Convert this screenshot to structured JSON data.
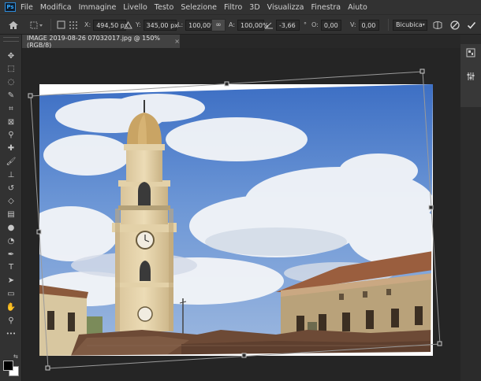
{
  "app": {
    "logo": "Ps"
  },
  "menu": [
    "File",
    "Modifica",
    "Immagine",
    "Livello",
    "Testo",
    "Selezione",
    "Filtro",
    "3D",
    "Visualizza",
    "Finestra",
    "Aiuto"
  ],
  "options": {
    "x_label": "X:",
    "x_value": "494,50 px",
    "y_label": "Y:",
    "y_value": "345,00 px",
    "w_label": "L:",
    "w_value": "100,00%",
    "h_label": "A:",
    "h_value": "100,00%",
    "angle_value": "-3,66",
    "hskew_label": "O:",
    "hskew_value": "0,00",
    "vskew_label": "V:",
    "vskew_value": "0,00",
    "interpolation": "Bicubica"
  },
  "document": {
    "tab_title": "IMAGE 2019-08-26 07032017.jpg @ 150% (RGB/8)",
    "close_glyph": "×"
  },
  "tools": [
    {
      "name": "move-icon",
      "glyph": "✥"
    },
    {
      "name": "marquee-icon",
      "glyph": "⬚"
    },
    {
      "name": "lasso-icon",
      "glyph": "◌"
    },
    {
      "name": "quick-select-icon",
      "glyph": "✎"
    },
    {
      "name": "crop-icon",
      "glyph": "⌗"
    },
    {
      "name": "frame-icon",
      "glyph": "⊠"
    },
    {
      "name": "eyedropper-icon",
      "glyph": "⚲"
    },
    {
      "name": "healing-icon",
      "glyph": "✚"
    },
    {
      "name": "brush-icon",
      "glyph": "🖌"
    },
    {
      "name": "stamp-icon",
      "glyph": "⊥"
    },
    {
      "name": "history-brush-icon",
      "glyph": "↺"
    },
    {
      "name": "eraser-icon",
      "glyph": "◇"
    },
    {
      "name": "gradient-icon",
      "glyph": "▤"
    },
    {
      "name": "blur-icon",
      "glyph": "●"
    },
    {
      "name": "dodge-icon",
      "glyph": "◔"
    },
    {
      "name": "pen-icon",
      "glyph": "✒"
    },
    {
      "name": "type-icon",
      "glyph": "T"
    },
    {
      "name": "path-select-icon",
      "glyph": "➤"
    },
    {
      "name": "shape-icon",
      "glyph": "▭"
    },
    {
      "name": "hand-icon",
      "glyph": "✋"
    },
    {
      "name": "zoom-icon",
      "glyph": "⚲"
    },
    {
      "name": "more-icon",
      "glyph": "•••"
    }
  ]
}
